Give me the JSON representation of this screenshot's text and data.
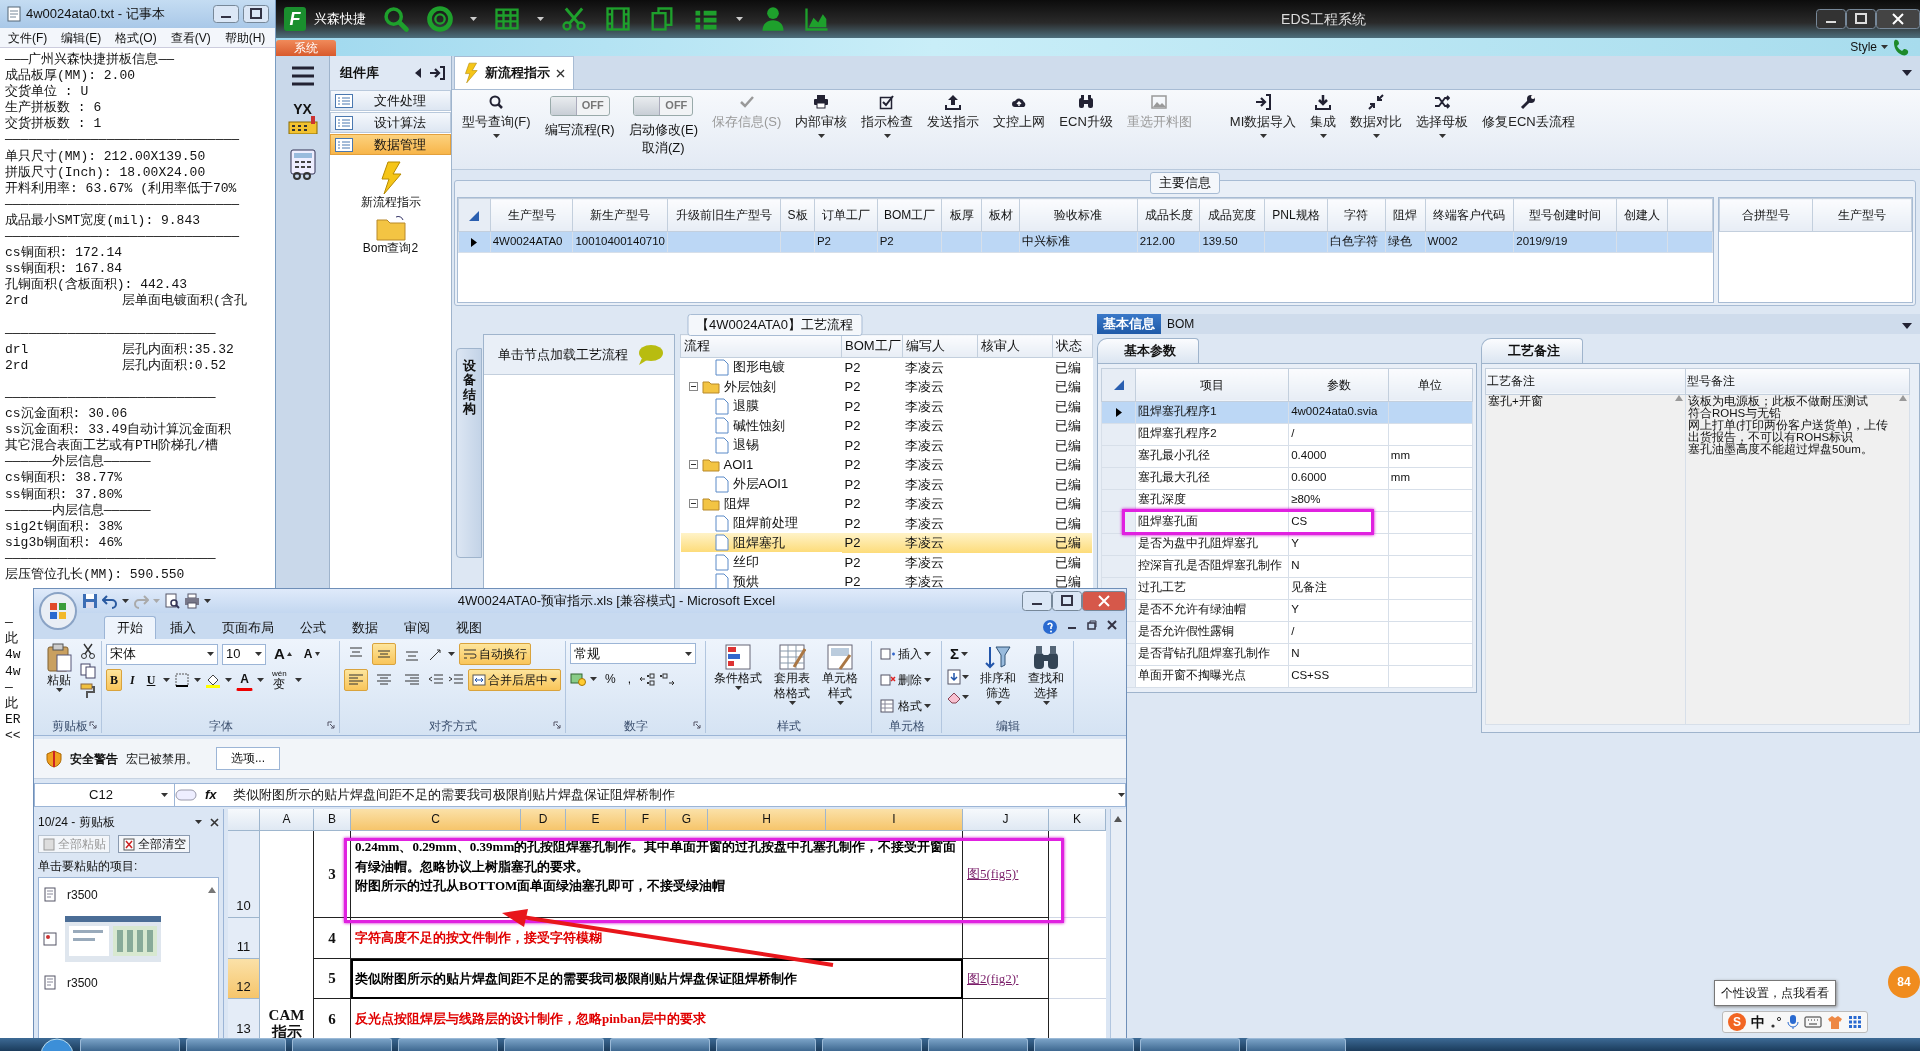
{
  "notepad": {
    "title": "4w0024ata0.txt - 记事本",
    "menu": [
      "文件(F)",
      "编辑(E)",
      "格式(O)",
      "查看(V)",
      "帮助(H)"
    ],
    "lines": [
      {
        "kind": "text",
        "text": "———广州兴森快捷拼板信息——"
      },
      {
        "kind": "text",
        "text": "成品板厚(MM): 2.00"
      },
      {
        "kind": "text",
        "text": "交货单位 : U"
      },
      {
        "kind": "text",
        "text": "生产拼板数 : 6"
      },
      {
        "kind": "text",
        "text": "交货拼板数 : 1"
      },
      {
        "kind": "text",
        "text": "——————————————————————————————"
      },
      {
        "kind": "text",
        "text": "单只尺寸(MM): 212.00X139.50"
      },
      {
        "kind": "text",
        "text": "拼版尺寸(Inch): 18.00X24.00"
      },
      {
        "kind": "text",
        "text": "开料利用率: 63.67% (利用率低于70%"
      },
      {
        "kind": "text",
        "text": "——————————————————————————————"
      },
      {
        "kind": "text",
        "text": "成品最小SMT宽度(mil): 9.843"
      },
      {
        "kind": "text",
        "text": "——————————————————————————————"
      },
      {
        "kind": "text",
        "text": "cs铜面积: 172.14"
      },
      {
        "kind": "text",
        "text": "ss铜面积: 167.84"
      },
      {
        "kind": "text",
        "text": "孔铜面积(含板面积): 442.43"
      },
      {
        "kind": "text",
        "text": "2rd            层单面电镀面积(含孔"
      },
      {
        "kind": "blank"
      },
      {
        "kind": "text",
        "text": "———————————————————————————"
      },
      {
        "kind": "text",
        "text": "drl            层孔内面积:35.32"
      },
      {
        "kind": "text",
        "text": "2rd            层孔内面积:0.52"
      },
      {
        "kind": "blank"
      },
      {
        "kind": "text",
        "text": "———————————————————————————"
      },
      {
        "kind": "text",
        "text": "cs沉金面积: 30.06"
      },
      {
        "kind": "text",
        "text": "ss沉金面积: 33.49自动计算沉金面积"
      },
      {
        "kind": "text",
        "text": "其它混合表面工艺或有PTH阶梯孔/槽"
      },
      {
        "kind": "text",
        "text": "——————外层信息——————"
      },
      {
        "kind": "text",
        "text": "cs铜面积: 38.77%"
      },
      {
        "kind": "text",
        "text": "ss铜面积: 37.80%"
      },
      {
        "kind": "text",
        "text": "——————内层信息——————"
      },
      {
        "kind": "text",
        "text": "sig2t铜面积: 38%"
      },
      {
        "kind": "text",
        "text": "sig3b铜面积: 46%"
      },
      {
        "kind": "text",
        "text": "———————————————————————————"
      },
      {
        "kind": "text",
        "text": "层压管位孔长(MM): 590.550"
      },
      {
        "kind": "blank"
      },
      {
        "kind": "blank"
      },
      {
        "kind": "text",
        "text": "—"
      },
      {
        "kind": "text",
        "text": "此"
      },
      {
        "kind": "text",
        "text": "4w"
      },
      {
        "kind": "text",
        "text": "4w"
      },
      {
        "kind": "text",
        "text": "—"
      },
      {
        "kind": "text",
        "text": "此"
      },
      {
        "kind": "text",
        "text": "ER"
      },
      {
        "kind": "text",
        "text": "<<"
      }
    ]
  },
  "app": {
    "logo_letter": "F",
    "brand": "兴森快捷",
    "title": "EDS工程系统",
    "menu_tab": "系统",
    "style_label": "Style",
    "rail_label": "YX",
    "side_header": "组件库",
    "side_items": [
      {
        "label": "文件处理",
        "selected": false
      },
      {
        "label": "设计算法",
        "selected": false
      },
      {
        "label": "数据管理",
        "selected": true
      }
    ],
    "launchers": [
      {
        "kind": "bolt",
        "label": "新流程指示"
      },
      {
        "kind": "folder",
        "label": "Bom查询2"
      }
    ],
    "doc_tabs": [
      {
        "label": "新流程指示",
        "selected": true
      }
    ],
    "toolbar": [
      {
        "kind": "button",
        "label": "型号查询(F)",
        "dropdown": true,
        "disabled": false
      },
      {
        "kind": "toggle",
        "switch": "OFF",
        "on": false,
        "label": "编写流程(R)"
      },
      {
        "kind": "toggle",
        "switch": "OFF",
        "on": false,
        "label": "启动修改(E)",
        "sublabel": "取消(Z)"
      },
      {
        "kind": "button",
        "label": "保存信息(S)",
        "dropdown": false,
        "disabled": true
      },
      {
        "kind": "button",
        "label": "内部审核",
        "dropdown": true,
        "disabled": false
      },
      {
        "kind": "button",
        "label": "指示检查",
        "dropdown": true,
        "disabled": false
      },
      {
        "kind": "button",
        "label": "发送指示",
        "dropdown": false,
        "disabled": false
      },
      {
        "kind": "button",
        "label": "文控上网",
        "dropdown": false,
        "disabled": false
      },
      {
        "kind": "button",
        "label": "ECN升级",
        "dropdown": false,
        "disabled": false
      },
      {
        "kind": "button",
        "label": "重选开料图",
        "dropdown": false,
        "disabled": true
      },
      {
        "kind": "button",
        "label": "MI数据导入",
        "dropdown": true,
        "disabled": false
      },
      {
        "kind": "button",
        "label": "集成",
        "dropdown": true,
        "disabled": false
      },
      {
        "kind": "button",
        "label": "数据对比",
        "dropdown": true,
        "disabled": false
      },
      {
        "kind": "button",
        "label": "选择母板",
        "dropdown": true,
        "disabled": false
      },
      {
        "kind": "button",
        "label": "修复ECN丢流程",
        "dropdown": false,
        "disabled": false
      }
    ],
    "main_info": {
      "title": "主要信息",
      "columns": [
        "生产型号",
        "新生产型号",
        "升级前旧生产型号",
        "S板",
        "订单工厂",
        "BOM工厂",
        "板厚",
        "板材",
        "验收标准",
        "成品长度",
        "成品宽度",
        "PNL规格",
        "字符",
        "阻焊",
        "终端客户代码",
        "型号创建时间",
        "创建人"
      ],
      "rows": [
        {
          "selected": true,
          "cells": [
            "4W0024ATA0",
            "10010400140710",
            null,
            null,
            "P2",
            "P2",
            null,
            null,
            "中兴标准",
            "212.00",
            "139.50",
            null,
            "白色字符",
            "绿色",
            "W002",
            "2019/9/19",
            null
          ]
        }
      ],
      "side_columns": [
        "合拼型号",
        "生产型号"
      ]
    },
    "process": {
      "title": "【4W0024ATA0】工艺流程",
      "side_tab": "设备结构",
      "hint": "单击节点加载工艺流程",
      "columns": [
        "流程",
        "BOM工厂",
        "编写人",
        "核审人",
        "状态"
      ],
      "tree": [
        {
          "kind": "leaf",
          "label": "图形电镀",
          "bom": "P2",
          "author": "李凌云",
          "status": "已编",
          "selected": false
        },
        {
          "kind": "folder",
          "label": "外层蚀刻",
          "bom": "P2",
          "author": "李凌云",
          "status": "已编",
          "selected": false,
          "expanded": true,
          "children": [
            {
              "kind": "leaf",
              "label": "退膜",
              "bom": "P2",
              "author": "李凌云",
              "status": "已编",
              "selected": false
            },
            {
              "kind": "leaf",
              "label": "碱性蚀刻",
              "bom": "P2",
              "author": "李凌云",
              "status": "已编",
              "selected": false
            },
            {
              "kind": "leaf",
              "label": "退锡",
              "bom": "P2",
              "author": "李凌云",
              "status": "已编",
              "selected": false
            }
          ]
        },
        {
          "kind": "folder",
          "label": "AOI1",
          "bom": "P2",
          "author": "李凌云",
          "status": "已编",
          "selected": false,
          "expanded": true,
          "children": [
            {
              "kind": "leaf",
              "label": "外层AOI1",
              "bom": "P2",
              "author": "李凌云",
              "status": "已编",
              "selected": false
            }
          ]
        },
        {
          "kind": "folder",
          "label": "阻焊",
          "bom": "P2",
          "author": "李凌云",
          "status": "已编",
          "selected": false,
          "expanded": true,
          "children": [
            {
              "kind": "leaf",
              "label": "阻焊前处理",
              "bom": "P2",
              "author": "李凌云",
              "status": "已编",
              "selected": false
            },
            {
              "kind": "leaf",
              "label": "阻焊塞孔",
              "bom": "P2",
              "author": "李凌云",
              "status": "已编",
              "selected": true
            },
            {
              "kind": "leaf",
              "label": "丝印",
              "bom": "P2",
              "author": "李凌云",
              "status": "已编",
              "selected": false
            },
            {
              "kind": "leaf",
              "label": "预烘",
              "bom": "P2",
              "author": "李凌云",
              "status": "已编",
              "selected": false
            }
          ]
        }
      ]
    },
    "info_tabs": [
      {
        "label": "基本信息",
        "selected": true
      },
      {
        "label": "BOM",
        "selected": false
      }
    ],
    "params": {
      "tab": "基本参数",
      "columns": [
        "项目",
        "参数",
        "单位"
      ],
      "rows": [
        {
          "item": "阻焊塞孔程序1",
          "value": "4w0024ata0.svia",
          "selected": true,
          "highlighted": false
        },
        {
          "item": "阻焊塞孔程序2",
          "value": "/",
          "selected": false,
          "highlighted": false
        },
        {
          "item": "塞孔最小孔径",
          "value": "0.4000",
          "unit": "mm",
          "selected": false,
          "highlighted": false
        },
        {
          "item": "塞孔最大孔径",
          "value": "0.6000",
          "unit": "mm",
          "selected": false,
          "highlighted": false
        },
        {
          "item": "塞孔深度",
          "value": "≥80%",
          "selected": false,
          "highlighted": false
        },
        {
          "item": "阻焊塞孔面",
          "value": "CS",
          "selected": false,
          "highlighted": true
        },
        {
          "item": "是否为盘中孔阻焊塞孔",
          "value": "Y",
          "selected": false,
          "highlighted": false
        },
        {
          "item": "控深盲孔是否阻焊塞孔制作",
          "value": "N",
          "selected": false,
          "highlighted": false
        },
        {
          "item": "过孔工艺",
          "value": "见备注",
          "selected": false,
          "highlighted": false
        },
        {
          "item": "是否不允许有绿油帽",
          "value": "Y",
          "selected": false,
          "highlighted": false
        },
        {
          "item": "是否允许假性露铜",
          "value": "/",
          "selected": false,
          "highlighted": false
        },
        {
          "item": "是否背钻孔阻焊塞孔制作",
          "value": "N",
          "selected": false,
          "highlighted": false
        },
        {
          "item": "单面开窗不掏曝光点",
          "value": "CS+SS",
          "selected": false,
          "highlighted": false
        }
      ]
    },
    "notes": {
      "tab": "工艺备注",
      "columns": [
        "工艺备注",
        "型号备注"
      ],
      "process_note": "塞孔+开窗",
      "model_note": [
        "该板为电源板；此板不做耐压测试",
        "符合ROHS与无铅",
        "网上打单(打印两份客户送货单)，上传出货报告，不可以有ROHS标识",
        "塞孔油墨高度不能超过焊盘50um。"
      ]
    },
    "tooltip": "个性设置，点我看看",
    "badge": "84"
  },
  "excel": {
    "title": "4W0024ATA0-预审指示.xls  [兼容模式] - Microsoft Excel",
    "tabs": [
      {
        "label": "开始",
        "selected": true
      },
      {
        "label": "插入",
        "selected": false
      },
      {
        "label": "页面布局",
        "selected": false
      },
      {
        "label": "公式",
        "selected": false
      },
      {
        "label": "数据",
        "selected": false
      },
      {
        "label": "审阅",
        "selected": false
      },
      {
        "label": "视图",
        "selected": false
      }
    ],
    "ribbon": {
      "groups": [
        {
          "label": "剪贴板",
          "launcher": true
        },
        {
          "label": "字体",
          "launcher": true
        },
        {
          "label": "对齐方式",
          "launcher": true
        },
        {
          "label": "数字",
          "launcher": true
        },
        {
          "label": "样式",
          "launcher": false
        },
        {
          "label": "单元格",
          "launcher": false
        },
        {
          "label": "编辑",
          "launcher": false
        }
      ],
      "paste": "粘贴",
      "font": "宋体",
      "font_size": "10",
      "grow_shrink": [
        "A",
        "A"
      ],
      "font_styles": [
        {
          "label": "B",
          "on": true
        },
        {
          "label": "I",
          "on": false
        },
        {
          "label": "U",
          "on": false
        }
      ],
      "font_color": "A",
      "phonetic": {
        "hint": "wén",
        "char": "变"
      },
      "align_vertical": [
        {
          "selected": false
        },
        {
          "selected": true
        },
        {
          "selected": false
        }
      ],
      "align_horizontal": [
        {
          "selected": true
        },
        {
          "selected": false
        },
        {
          "selected": false
        }
      ],
      "wrap": {
        "label": "自动换行",
        "on": true
      },
      "merge": {
        "label": "合并后居中",
        "on": true
      },
      "number_format": "常规",
      "number_symbols": [
        "%",
        ","
      ],
      "style_buttons": [
        "条件格式",
        "套用表格格式",
        "单元格样式"
      ],
      "cell_buttons": [
        "插入",
        "删除",
        "格式"
      ],
      "sum": "Σ",
      "edit_buttons": [
        "排序和筛选",
        "查找和选择"
      ]
    },
    "security": {
      "title": "安全警告",
      "message": "宏已被禁用。",
      "button": "选项..."
    },
    "formula": {
      "cell": "C12",
      "fx": "fx",
      "content": "类似附图所示的贴片焊盘间距不足的需要我司极限削贴片焊盘保证阻焊桥制作"
    },
    "clipboard": {
      "title": "10/24 - 剪贴板",
      "buttons": [
        {
          "label": "全部粘贴",
          "disabled": true
        },
        {
          "label": "全部清空",
          "disabled": false
        }
      ],
      "hint": "单击要粘贴的项目:",
      "items": [
        {
          "kind": "text",
          "label": "r3500"
        },
        {
          "kind": "picture"
        },
        {
          "kind": "text",
          "label": "r3500"
        }
      ]
    },
    "sheet": {
      "columns": [
        {
          "label": "A",
          "selected": false
        },
        {
          "label": "B",
          "selected": false
        },
        {
          "label": "C",
          "selected": true
        },
        {
          "label": "D",
          "selected": true
        },
        {
          "label": "E",
          "selected": true
        },
        {
          "label": "F",
          "selected": true
        },
        {
          "label": "G",
          "selected": true
        },
        {
          "label": "H",
          "selected": true
        },
        {
          "label": "I",
          "selected": true
        },
        {
          "label": "J",
          "selected": false
        },
        {
          "label": "K",
          "selected": false
        }
      ],
      "merged_label": "CAM 指示",
      "rows": [
        {
          "header": "10",
          "selected": false,
          "number": "3",
          "color": "#000000",
          "paragraphs": [
            "0.24mm、0.29mm、0.39mm的孔按阻焊塞孔制作。其中单面开窗的过孔按盘中孔塞孔制作，不接受开窗面有绿油帽。忽略协议上树脂塞孔的要求。",
            "附图所示的过孔从BOTTOM面单面绿油塞孔即可，不接受绿油帽"
          ],
          "link": "图5(fig5)'",
          "highlighted": true
        },
        {
          "header": "11",
          "selected": false,
          "number": "4",
          "color": "#e00000",
          "paragraphs": [
            "字符高度不足的按文件制作，接受字符模糊"
          ],
          "highlighted": false
        },
        {
          "header": "12",
          "selected": true,
          "number": "5",
          "color": "#000000",
          "paragraphs": [
            "类似附图所示的贴片焊盘间距不足的需要我司极限削贴片焊盘保证阻焊桥制作"
          ],
          "link": "图2(fig2)'",
          "highlighted": false
        },
        {
          "header": "13",
          "selected": false,
          "number": "6",
          "color": "#e00000",
          "paragraphs": [
            "反光点按阻焊层与线路层的设计制作，忽略pinban层中的要求"
          ],
          "highlighted": false
        }
      ]
    }
  },
  "ime": {
    "logo": "S",
    "mode": "中"
  }
}
